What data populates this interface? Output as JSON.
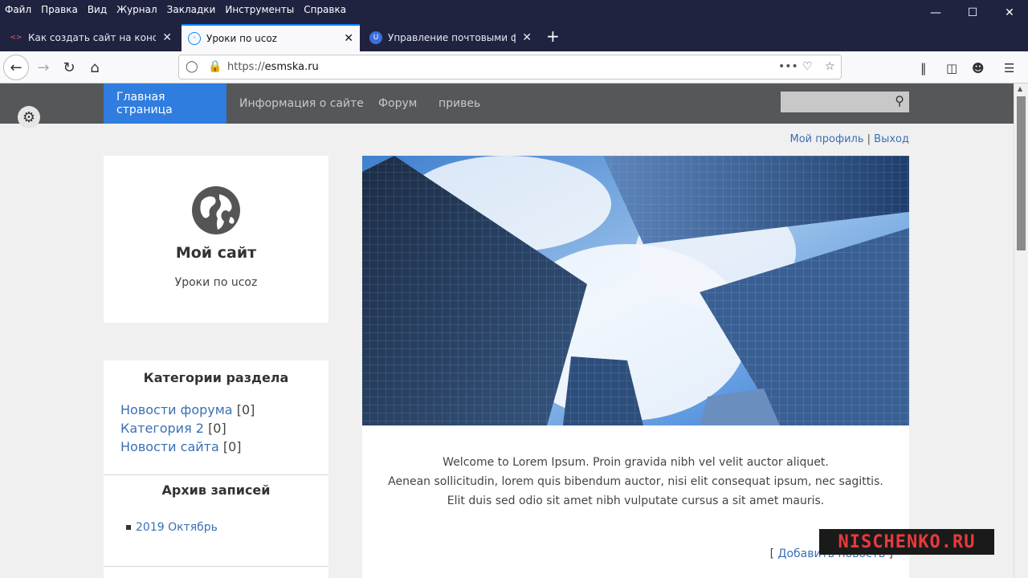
{
  "browser": {
    "menu": [
      "Файл",
      "Правка",
      "Вид",
      "Журнал",
      "Закладки",
      "Инструменты",
      "Справка"
    ],
    "tabs": [
      {
        "title": "Как создать сайт на конструкт",
        "active": false
      },
      {
        "title": "Уроки по ucoz",
        "active": true
      },
      {
        "title": "Управление почтовыми фор",
        "active": false
      }
    ],
    "url_prefix": "https://",
    "url_host": "esmska.ru"
  },
  "site": {
    "nav": [
      "Главная страница",
      "Информация о сайте",
      "Форум",
      "привеь"
    ],
    "profile_link": "Мой профиль",
    "separator": "|",
    "logout_link": "Выход",
    "title": "Мой сайт",
    "subtitle": "Уроки по ucoz",
    "categories_heading": "Категории раздела",
    "categories": [
      {
        "name": "Новости форума",
        "count": "[0]"
      },
      {
        "name": "Категория 2",
        "count": "[0]"
      },
      {
        "name": "Новости сайта",
        "count": "[0]"
      }
    ],
    "archive_heading": "Архив записей",
    "archive_items": [
      "2019 Октябрь"
    ],
    "welcome_lines": [
      "Welcome to Lorem Ipsum. Proin gravida nibh vel velit auctor aliquet.",
      "Aenean sollicitudin, lorem quis bibendum auctor, nisi elit consequat ipsum, nec sagittis.",
      "Elit duis sed odio sit amet nibh vulputate cursus a sit amet mauris."
    ],
    "add_news_open": "[",
    "add_news_link": "Добавить новость",
    "add_news_close": "]"
  },
  "watermark": "NISCHENKO.RU",
  "colors": {
    "chrome_dark": "#202340",
    "nav_bg": "#555759",
    "nav_active": "#2f7ddf",
    "link": "#3a6fb5"
  }
}
